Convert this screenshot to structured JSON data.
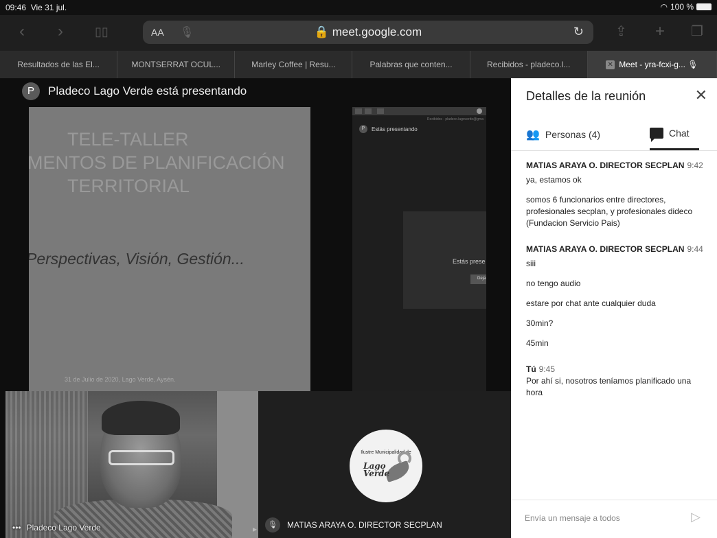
{
  "status": {
    "time": "09:46",
    "date": "Vie 31 jul.",
    "wifi": "wifi-icon",
    "battery": "100 %"
  },
  "toolbar": {
    "text_size": "AA",
    "url": "meet.google.com",
    "icons": [
      "back-icon",
      "forward-icon",
      "bookmarks-icon",
      "microphone-icon",
      "reload-icon",
      "share-icon",
      "add-tab-icon",
      "tabs-icon"
    ]
  },
  "tabs": [
    {
      "label": "Resultados de las El..."
    },
    {
      "label": "MONTSERRAT OCUL..."
    },
    {
      "label": "Marley Coffee | Resu..."
    },
    {
      "label": "Palabras que conten..."
    },
    {
      "label": "Recibidos - pladeco.l..."
    },
    {
      "label": "Meet - yra-fcxi-g..."
    }
  ],
  "stage": {
    "presenter_initial": "P",
    "presenter_text": "Pladeco Lago Verde está presentando",
    "slide": {
      "title_line1": "TELE-TALLER",
      "title_line2": "MENTOS DE PLANIFICACIÓN",
      "title_line3": "TERRITORIAL",
      "subtitle": "Perspectivas, Visión, Gestión...",
      "date": "31 de Julio de 2020, Lago Verde, Aysén."
    },
    "screenshare": {
      "address": "Recibidos - pladeco.lagoverde@gma",
      "initial": "P",
      "presenting": "Estás presentando",
      "card_text": "Estás prese",
      "card_button": "Deja"
    },
    "tile_self": {
      "name": "Pladeco Lago Verde",
      "menu": "•••"
    },
    "tile_other": {
      "name": "MATIAS ARAYA O. DIRECTOR SECPLAN",
      "logo_small": "Ilustre Municipalidad de",
      "logo_name_1": "Lago",
      "logo_name_2": "Verde"
    }
  },
  "panel": {
    "title": "Detalles de la reunión",
    "people_tab": "Personas (4)",
    "chat_tab": "Chat",
    "messages": [
      {
        "author": "MATIAS ARAYA O. DIRECTOR SECPLAN",
        "time": "9:42",
        "lines": [
          "ya, estamos ok",
          "somos 6 funcionarios entre directores, profesionales secplan, y profesionales dideco (Fundacion Servicio Pais)"
        ]
      },
      {
        "author": "MATIAS ARAYA O. DIRECTOR SECPLAN",
        "time": "9:44",
        "lines": [
          "siii",
          "no tengo audio",
          "estare por chat ante cualquier duda",
          "30min?",
          "45min"
        ]
      },
      {
        "author": "Tú",
        "time": "9:45",
        "lines": [
          "Por ahí si, nosotros teníamos planificado una hora"
        ]
      }
    ],
    "composer_placeholder": "Envía un mensaje a todos"
  }
}
